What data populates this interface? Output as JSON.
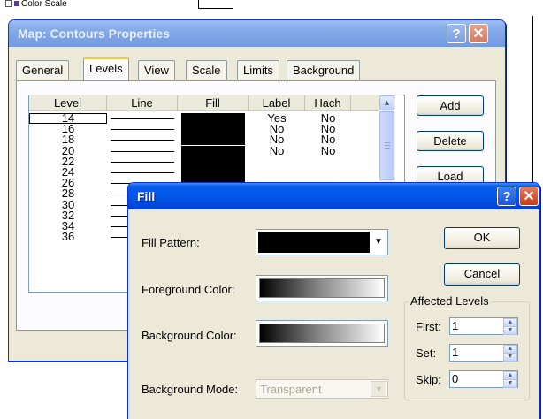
{
  "background_app": {
    "tree_item_label": "Color Scale"
  },
  "contours_dialog": {
    "title": "Map: Contours Properties",
    "tabs": [
      "General",
      "Levels",
      "View",
      "Scale",
      "Limits",
      "Background"
    ],
    "active_tab": "Levels",
    "columns": [
      "Level",
      "Line",
      "Fill",
      "Label",
      "Hach"
    ],
    "rows": [
      {
        "level": "14",
        "label": "Yes",
        "hach": "No"
      },
      {
        "level": "16",
        "label": "No",
        "hach": "No"
      },
      {
        "level": "18",
        "label": "No",
        "hach": "No"
      },
      {
        "level": "20",
        "label": "No",
        "hach": "No"
      },
      {
        "level": "22",
        "label": "",
        "hach": ""
      },
      {
        "level": "24",
        "label": "",
        "hach": ""
      },
      {
        "level": "26",
        "label": "",
        "hach": ""
      },
      {
        "level": "28",
        "label": "",
        "hach": ""
      },
      {
        "level": "30",
        "label": "",
        "hach": ""
      },
      {
        "level": "32",
        "label": "",
        "hach": ""
      },
      {
        "level": "34",
        "label": "",
        "hach": ""
      },
      {
        "level": "36",
        "label": "",
        "hach": ""
      }
    ],
    "buttons": {
      "add": "Add",
      "delete": "Delete",
      "load": "Load"
    }
  },
  "fill_dialog": {
    "title": "Fill",
    "fill_pattern_label": "Fill Pattern:",
    "foreground_color_label": "Foreground Color:",
    "background_color_label": "Background Color:",
    "background_mode_label": "Background Mode:",
    "background_mode_value": "Transparent",
    "ok": "OK",
    "cancel": "Cancel",
    "affected_levels": {
      "title": "Affected Levels",
      "first_label": "First:",
      "first_value": "1",
      "set_label": "Set:",
      "set_value": "1",
      "skip_label": "Skip:",
      "skip_value": "0"
    }
  },
  "colors": {
    "titlebar_active": "#0054e3",
    "titlebar_inactive": "#7a9fe4",
    "dialog_face": "#ece9d8",
    "fill_swatch": "#000000",
    "close_button": "#c93b12"
  },
  "icons": {
    "help": "question-mark",
    "close": "x-mark",
    "dropdown": "down-triangle",
    "spin_up": "up-triangle",
    "spin_down": "down-triangle"
  }
}
